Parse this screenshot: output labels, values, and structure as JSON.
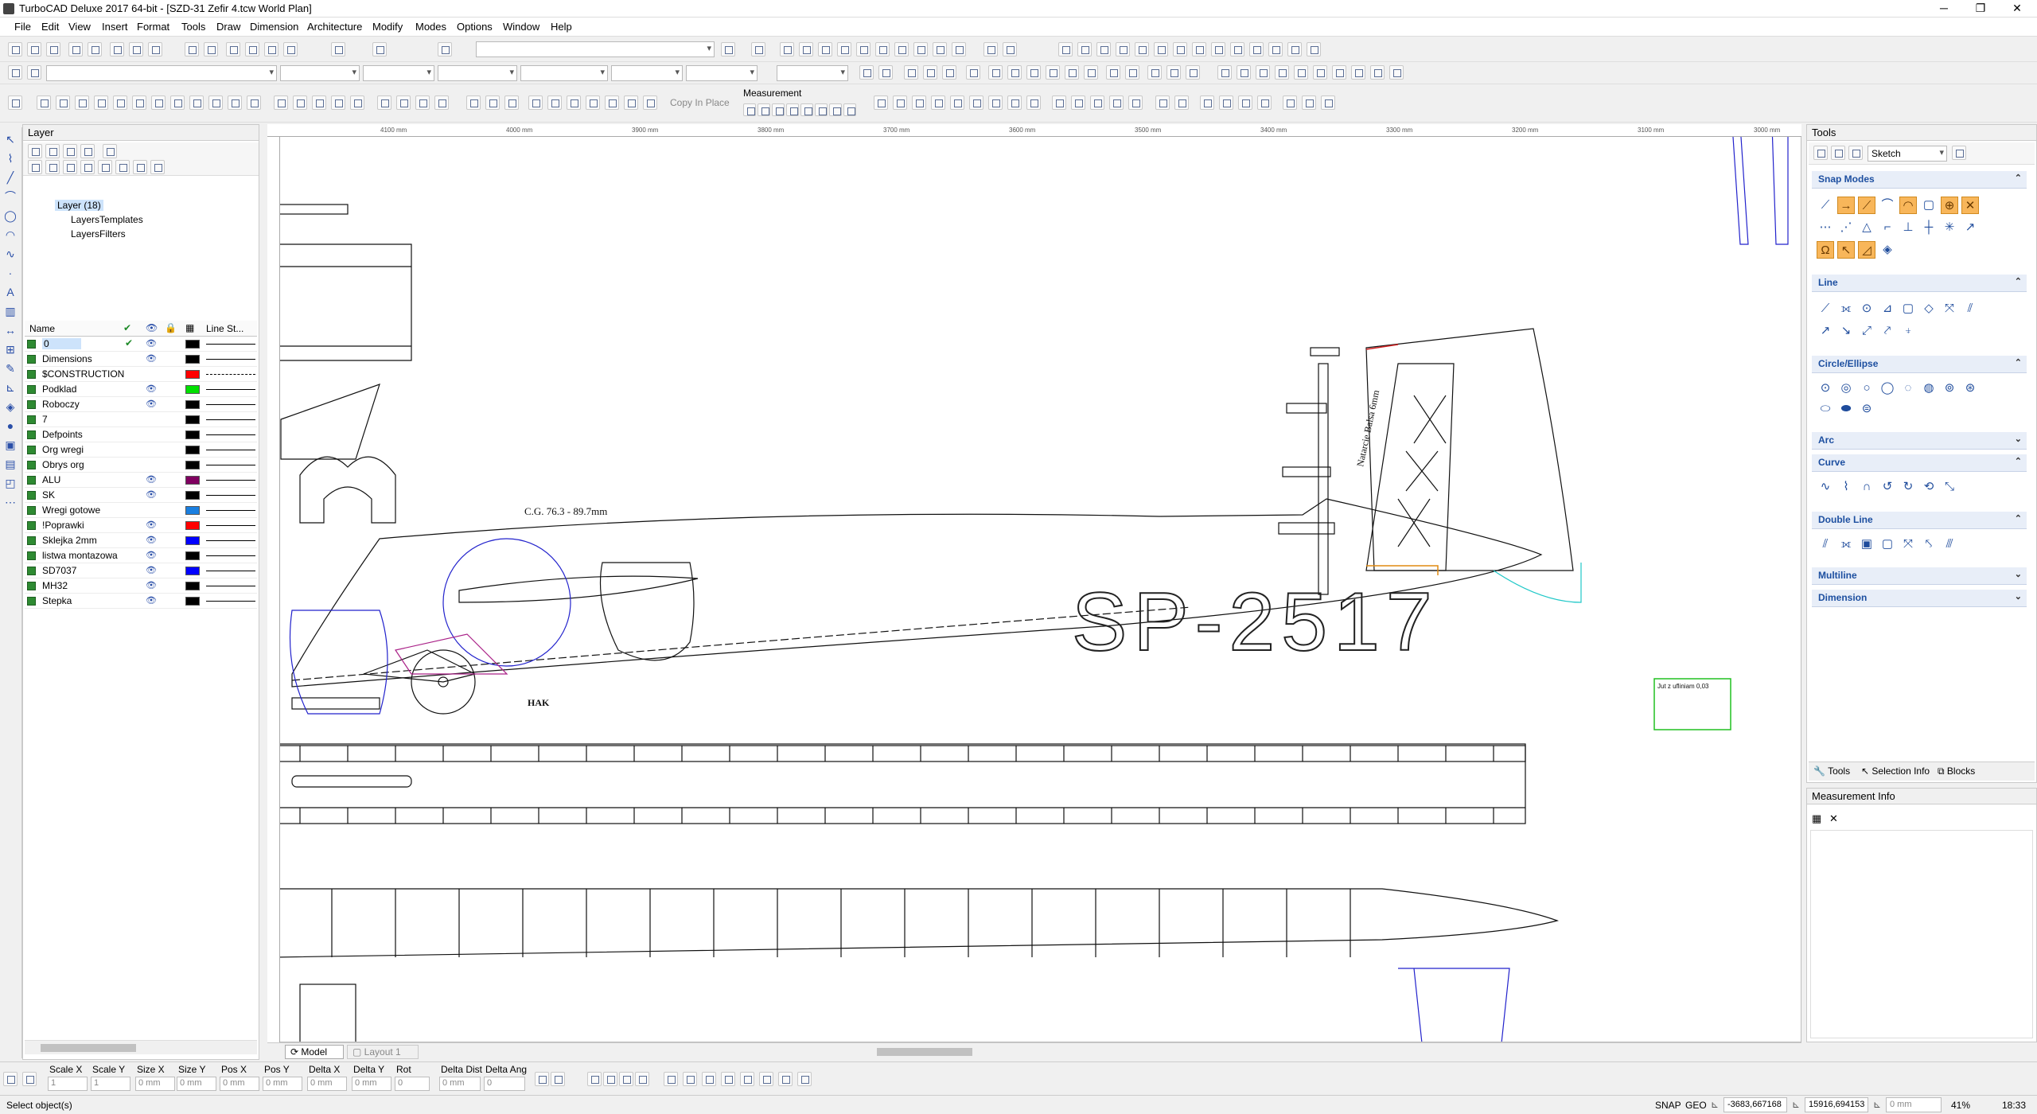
{
  "titlebar": {
    "title": "TurboCAD Deluxe 2017 64-bit - [SZD-31 Zefir 4.tcw World Plan]",
    "min": "─",
    "max": "❐",
    "close": "✕"
  },
  "menu": [
    "File",
    "Edit",
    "View",
    "Insert",
    "Format",
    "Tools",
    "Draw",
    "Dimension",
    "Architecture",
    "Modify",
    "Modes",
    "Options",
    "Window",
    "Help"
  ],
  "toolbar3": {
    "copy_in_place": "Copy In Place",
    "measurement": "Measurement"
  },
  "layer_panel": {
    "title": "Layer",
    "tree": [
      {
        "label": "Layer (18)"
      },
      {
        "label": "LayersTemplates"
      },
      {
        "label": "LayersFilters"
      }
    ],
    "columns": {
      "name": "Name",
      "line_style": "Line St..."
    },
    "rows": [
      {
        "name": "0",
        "color": "#000000",
        "visible": true,
        "current": true
      },
      {
        "name": "Dimensions",
        "color": "#000000",
        "visible": true
      },
      {
        "name": "$CONSTRUCTION",
        "color": "#ff0000",
        "visible": false,
        "dashed": true
      },
      {
        "name": "Podklad",
        "color": "#00e000",
        "visible": true
      },
      {
        "name": "Roboczy",
        "color": "#000000",
        "visible": true
      },
      {
        "name": "7",
        "color": "#000000",
        "visible": false
      },
      {
        "name": "Defpoints",
        "color": "#000000",
        "visible": false
      },
      {
        "name": "Org wregi",
        "color": "#000000",
        "visible": false
      },
      {
        "name": "Obrys org",
        "color": "#000000",
        "visible": false
      },
      {
        "name": "ALU",
        "color": "#800060",
        "visible": true
      },
      {
        "name": "SK",
        "color": "#000000",
        "visible": true
      },
      {
        "name": "Wregi gotowe",
        "color": "#1a7fe0",
        "visible": false
      },
      {
        "name": "!Poprawki",
        "color": "#ff0000",
        "visible": true
      },
      {
        "name": "Sklejka 2mm",
        "color": "#0000ff",
        "visible": true
      },
      {
        "name": "listwa montazowa",
        "color": "#000000",
        "visible": true
      },
      {
        "name": "SD7037",
        "color": "#0000ff",
        "visible": true
      },
      {
        "name": "MH32",
        "color": "#000000",
        "visible": true
      },
      {
        "name": "Stepka",
        "color": "#000000",
        "visible": true
      }
    ]
  },
  "ruler": {
    "labels": [
      "4100 mm",
      "4000 mm",
      "3900 mm",
      "3800 mm",
      "3700 mm",
      "3600 mm",
      "3500 mm",
      "3400 mm",
      "3300 mm",
      "3200 mm",
      "3100 mm",
      "3000 mm"
    ]
  },
  "drawing": {
    "cg_label": "C.G. 76.3 - 89.7mm",
    "registration": "SP-2517",
    "hak": "HAK",
    "balsa_note": "Natarcie Balsa 6mm",
    "insert_label": "Jut z ufliniam 0,03"
  },
  "tools_panel": {
    "title": "Tools",
    "mode": "Sketch",
    "sections": [
      "Snap Modes",
      "Line",
      "Circle/Ellipse",
      "Arc",
      "Curve",
      "Double Line",
      "Multiline",
      "Dimension"
    ],
    "tabs": [
      "Tools",
      "Selection Info",
      "Blocks"
    ]
  },
  "measurement_panel": {
    "title": "Measurement Info"
  },
  "bottom_tabs": {
    "model": "Model",
    "layout": "Layout 1"
  },
  "inspector": {
    "labels": [
      "Scale X",
      "Scale Y",
      "Size X",
      "Size Y",
      "Pos X",
      "Pos Y",
      "Delta X",
      "Delta Y",
      "Rot",
      "Delta Dist",
      "Delta Ang"
    ],
    "values": [
      "1",
      "1",
      "0 mm",
      "0 mm",
      "0 mm",
      "0 mm",
      "0 mm",
      "0 mm",
      "0",
      "0 mm",
      "0"
    ]
  },
  "status": {
    "text": "Select object(s)",
    "snap": "SNAP",
    "geo": "GEO",
    "x": "-3683,667168",
    "y": "15916,694153",
    "z": "0 mm",
    "zoom": "41%",
    "time": "18:33"
  }
}
